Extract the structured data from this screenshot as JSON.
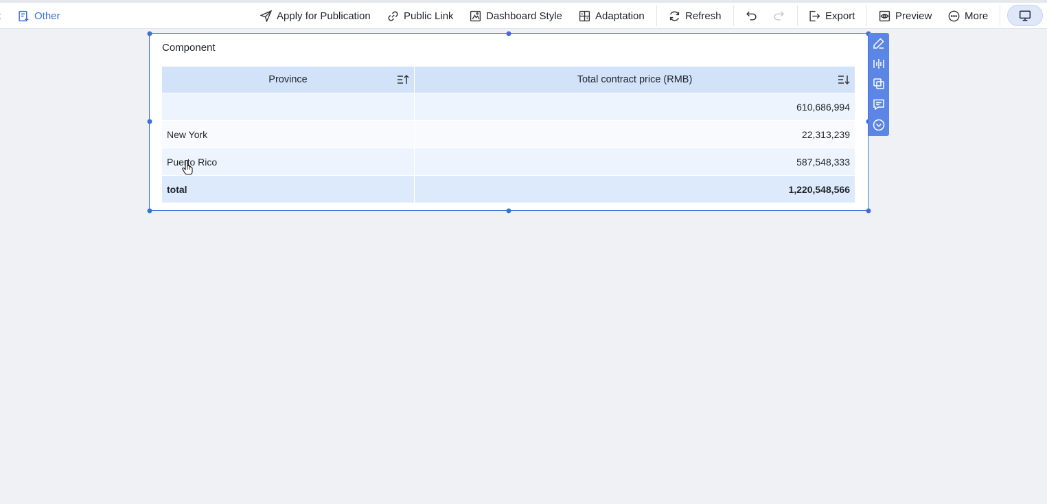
{
  "toolbar": {
    "left_fragment": "t",
    "other_label": "Other",
    "apply_label": "Apply for Publication",
    "public_link_label": "Public Link",
    "dashboard_style_label": "Dashboard Style",
    "adaptation_label": "Adaptation",
    "refresh_label": "Refresh",
    "export_label": "Export",
    "preview_label": "Preview",
    "more_label": "More"
  },
  "component": {
    "title": "Component",
    "table": {
      "headers": [
        "Province",
        "Total contract price (RMB)"
      ],
      "rows": [
        {
          "province": "",
          "price": "610,686,994"
        },
        {
          "province": "New York",
          "price": "22,313,239"
        },
        {
          "province": "Puerto Rico",
          "price": "587,548,333"
        }
      ],
      "total": {
        "label": "total",
        "price": "1,220,548,566"
      }
    }
  },
  "colors": {
    "accent": "#3e6fd8",
    "header_bg": "#d2e2f9",
    "side_toolbar": "#5b86e5",
    "canvas_bg": "#eff1f5"
  },
  "icons": {
    "other": "form-plus-icon",
    "apply": "paper-plane-icon",
    "public_link": "link-icon",
    "dashboard_style": "palette-icon",
    "adaptation": "grid-icon",
    "refresh": "refresh-icon",
    "undo": "undo-icon",
    "redo": "redo-icon",
    "export": "export-icon",
    "preview": "eye-icon",
    "more": "more-circle-icon",
    "device": "monitor-icon"
  }
}
